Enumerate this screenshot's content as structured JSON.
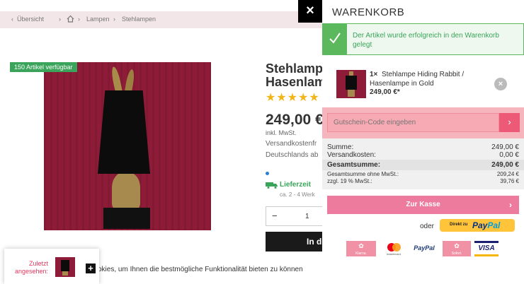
{
  "breadcrumb": {
    "back": "Übersicht",
    "separator": "›",
    "items": [
      "Lampen",
      "Stehlampen"
    ]
  },
  "product": {
    "stock_badge": "150 Artikel verfügbar",
    "title_line1": "Stehlampe",
    "title_line2": "Hasenlam",
    "stars": "★★★★★",
    "price": "249,00 €",
    "vat_note": "inkl. MwSt.",
    "shipping_line1": "Versandkostenfr",
    "shipping_line2": "Deutschlands ab",
    "delivery_label": "Lieferzeit",
    "delivery_sub": "ca. 2 - 4 Werk",
    "qty_minus": "−",
    "qty_value": "1",
    "buy_label": "In d"
  },
  "cookie_text": "okies, um Ihnen die bestmögliche Funktionalität bieten zu können",
  "last_seen": {
    "label": "Zuletzt angesehen:",
    "plus": "+"
  },
  "close_label": "×",
  "cart": {
    "title": "WARENKORB",
    "success_message": "Der Artikel wurde erfolgreich in den Warenkorb gelegt",
    "item": {
      "qty": "1×",
      "name": "Stehlampe Hiding Rabbit / Hasenlampe in Gold",
      "price": "249,00 €*",
      "remove": "×"
    },
    "voucher_placeholder": "Gutschein-Code eingeben",
    "voucher_button": "›",
    "summary": {
      "sum_label": "Summe:",
      "sum_value": "249,00 €",
      "shipping_label": "Versandkosten:",
      "shipping_value": "0,00 €",
      "total_label": "Gesamtsumme:",
      "total_value": "249,00 €",
      "net_label": "Gesamtsumme ohne MwSt.:",
      "net_value": "209,24 €",
      "tax_label": "zzgl. 19 % MwSt.:",
      "tax_value": "39,76 €"
    },
    "checkout_label": "Zur Kasse",
    "checkout_arrow": "›",
    "or_label": "oder",
    "paypal_direct": "Direkt zu",
    "paypal_pay": "Pay",
    "paypal_pal": "Pal",
    "payment_icons": {
      "klarna": "Klarna.",
      "mastercard": "mastercard",
      "paypal": "PayPal",
      "sofort": "Sofort.",
      "visa": "VISA"
    }
  },
  "colors": {
    "accent_pink": "#ec7b9d",
    "success_green": "#5cb85c",
    "star": "#f2b518"
  }
}
